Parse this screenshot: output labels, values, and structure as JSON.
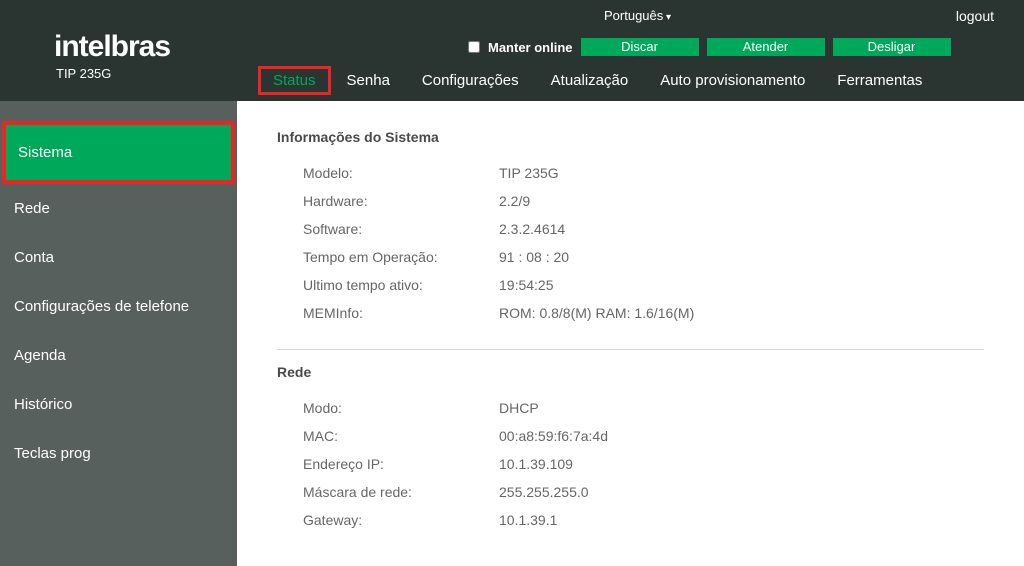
{
  "brand": "intelbras",
  "model": "TIP 235G",
  "language": "Português",
  "logout": "logout",
  "keep_online": {
    "label": "Manter online",
    "buttons": {
      "dial": "Discar",
      "answer": "Atender",
      "hangup": "Desligar"
    }
  },
  "tabs": {
    "status": "Status",
    "password": "Senha",
    "config": "Configurações",
    "update": "Atualização",
    "autoprov": "Auto provisionamento",
    "tools": "Ferramentas"
  },
  "sidebar": {
    "system": "Sistema",
    "network": "Rede",
    "account": "Conta",
    "phone_cfg": "Configurações de telefone",
    "agenda": "Agenda",
    "history": "Histórico",
    "progkeys": "Teclas prog"
  },
  "sections": {
    "system_info": {
      "title": "Informações do Sistema",
      "rows": {
        "model": {
          "label": "Modelo:",
          "value": "TIP 235G"
        },
        "hw": {
          "label": "Hardware:",
          "value": "2.2/9"
        },
        "sw": {
          "label": "Software:",
          "value": "2.3.2.4614"
        },
        "uptime": {
          "label": "Tempo em Operação:",
          "value": "91 : 08 : 20"
        },
        "last": {
          "label": "Ultimo tempo ativo:",
          "value": "19:54:25"
        },
        "mem": {
          "label": "MEMInfo:",
          "value": "ROM: 0.8/8(M)    RAM: 1.6/16(M)"
        }
      }
    },
    "network": {
      "title": "Rede",
      "rows": {
        "mode": {
          "label": "Modo:",
          "value": "DHCP"
        },
        "mac": {
          "label": "MAC:",
          "value": "00:a8:59:f6:7a:4d"
        },
        "ip": {
          "label": "Endereço IP:",
          "value": "10.1.39.109"
        },
        "mask": {
          "label": "Máscara de rede:",
          "value": "255.255.255.0"
        },
        "gw": {
          "label": "Gateway:",
          "value": "10.1.39.1"
        }
      }
    }
  }
}
